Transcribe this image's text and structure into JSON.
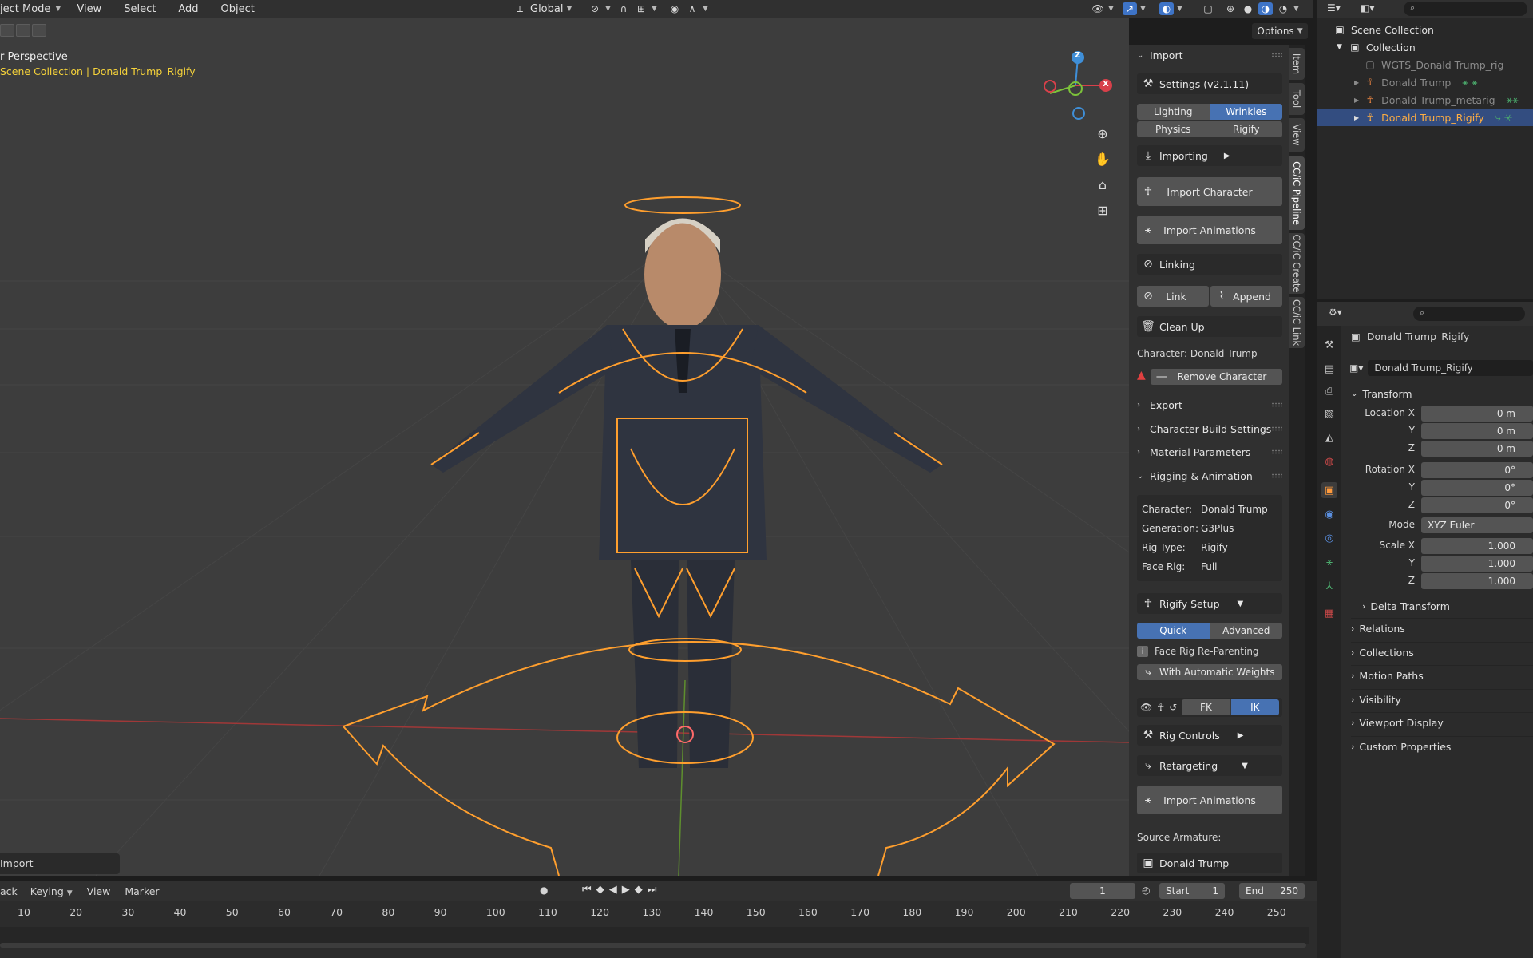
{
  "header": {
    "mode": "ject Mode",
    "menus": [
      "View",
      "Select",
      "Add",
      "Object"
    ],
    "transform_orientation": "Global",
    "options_label": "Options"
  },
  "viewport": {
    "view_name": "r Perspective",
    "collection_path": "Scene Collection | Donald Trump_Rigify",
    "last_operator": "Import",
    "gizmo_axes": [
      "Z",
      "X"
    ]
  },
  "npanel": {
    "import_header": "Import",
    "settings_label": "Settings  (v2.1.11)",
    "tabs_row1": [
      "Lighting",
      "Wrinkles"
    ],
    "tabs_row2": [
      "Physics",
      "Rigify"
    ],
    "importing_label": "Importing",
    "import_character_label": "Import Character",
    "import_animations_label": "Import Animations",
    "linking_label": "Linking",
    "link_label": "Link",
    "append_label": "Append",
    "cleanup_label": "Clean Up",
    "character_label": "Character: Donald Trump",
    "remove_character_label": "Remove Character",
    "sections": [
      "Export",
      "Character Build Settings",
      "Material Parameters",
      "Rigging & Animation"
    ],
    "info": {
      "rows": [
        {
          "k": "Character:",
          "v": "Donald Trump"
        },
        {
          "k": "Generation:",
          "v": "G3Plus"
        },
        {
          "k": "Rig Type:",
          "v": "Rigify"
        },
        {
          "k": "Face Rig:",
          "v": "Full"
        }
      ]
    },
    "rigify_setup_label": "Rigify Setup",
    "quick_label": "Quick",
    "advanced_label": "Advanced",
    "face_rig_label": "Face Rig Re-Parenting",
    "auto_weights_label": "With Automatic Weights",
    "fk_label": "FK",
    "ik_label": "IK",
    "rig_controls_label": "Rig Controls",
    "retargeting_label": "Retargeting",
    "import_animations2_label": "Import Animations",
    "source_armature_label": "Source Armature:",
    "source_armature_value": "Donald Trump"
  },
  "vtabs": [
    "Item",
    "Tool",
    "View",
    "CC/iC Pipeline",
    "CC/iC Create",
    "CC/iC Link"
  ],
  "outliner": {
    "rows": [
      {
        "label": "Scene Collection",
        "indent": 0
      },
      {
        "label": "Collection",
        "indent": 1
      },
      {
        "label": "WGTS_Donald Trump_rig",
        "indent": 2
      },
      {
        "label": "Donald Trump",
        "indent": 2
      },
      {
        "label": "Donald Trump_metarig",
        "indent": 2
      },
      {
        "label": "Donald Trump_Rigify",
        "indent": 2
      }
    ]
  },
  "properties": {
    "object_name": "Donald Trump_Rigify",
    "datablock_name": "Donald Trump_Rigify",
    "transform_label": "Transform",
    "location_x_label": "Location X",
    "rotation_x_label": "Rotation X",
    "scale_x_label": "Scale X",
    "axis_y": "Y",
    "axis_z": "Z",
    "mode_label": "Mode",
    "mode_value": "XYZ Euler",
    "loc": [
      "0 m",
      "0 m",
      "0 m"
    ],
    "rot": [
      "0°",
      "0°",
      "0°"
    ],
    "scale": [
      "1.000",
      "1.000",
      "1.000"
    ],
    "sections": [
      "Relations",
      "Collections",
      "Motion Paths",
      "Visibility",
      "Viewport Display",
      "Custom Properties"
    ],
    "delta_label": "Delta Transform"
  },
  "timeline": {
    "menus": [
      "ack",
      "Keying",
      "View",
      "Marker"
    ],
    "current_frame": "1",
    "start_label": "Start",
    "start_value": "1",
    "end_label": "End",
    "end_value": "250",
    "ticks": [
      "10",
      "20",
      "30",
      "40",
      "50",
      "60",
      "70",
      "80",
      "90",
      "100",
      "110",
      "120",
      "130",
      "140",
      "150",
      "160",
      "170",
      "180",
      "190",
      "200",
      "210",
      "220",
      "230",
      "240",
      "250"
    ]
  },
  "colors": {
    "selection_orange": "#ffa033",
    "accent_blue": "#4772b3",
    "viewport_bg": "#3d3d3d"
  }
}
